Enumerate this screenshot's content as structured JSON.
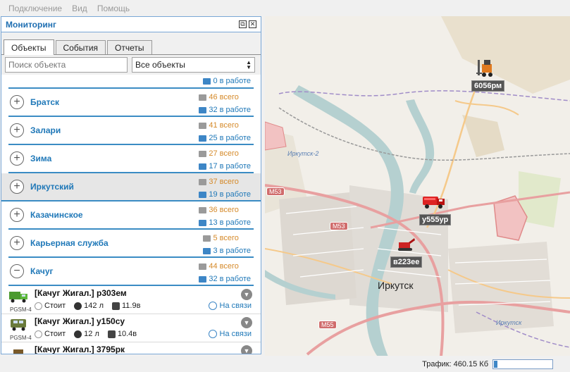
{
  "menu": [
    "Подключение",
    "Вид",
    "Помощь"
  ],
  "panel": {
    "title": "Мониторинг",
    "restore_glyph": "⧉",
    "close_glyph": "✕"
  },
  "tabs": [
    "Объекты",
    "События",
    "Отчеты"
  ],
  "filters": {
    "search_placeholder": "Поиск объекта",
    "select_value": "Все объекты"
  },
  "groups": [
    {
      "name": "",
      "total": "",
      "working": "0 в работе"
    },
    {
      "name": "Братск",
      "total": "46 всего",
      "working": "32 в работе"
    },
    {
      "name": "Залари",
      "total": "41 всего",
      "working": "25 в работе"
    },
    {
      "name": "Зима",
      "total": "27 всего",
      "working": "17 в работе"
    },
    {
      "name": "Иркутский",
      "total": "37 всего",
      "working": "19 в работе"
    },
    {
      "name": "Казачинское",
      "total": "36 всего",
      "working": "13 в работе"
    },
    {
      "name": "Карьерная служба",
      "total": "5 всего",
      "working": "3 в работе"
    },
    {
      "name": "Качуг",
      "total": "44 всего",
      "working": "32 в работе"
    }
  ],
  "vehicles": [
    {
      "title": "[Качуг Жигал.]  р303ем",
      "sub": "PGSM-4",
      "state": "Стоит",
      "fuel": "142 л",
      "battery": "11.9в",
      "link": "На связи"
    },
    {
      "title": "[Качуг Жигал.]  у150су",
      "sub": "PGSM-4",
      "state": "Стоит",
      "fuel": "12 л",
      "battery": "10.4в",
      "link": "На связи"
    },
    {
      "title": "[Качуг Жигал.]  3795рк",
      "sub": "",
      "state": "",
      "fuel": "",
      "battery": "",
      "link": ""
    }
  ],
  "map": {
    "city": "Иркутск",
    "labels": {
      "irkutsk2": "Иркутск-2",
      "irkutsk_river": "Иркутск"
    },
    "roads": {
      "m53a": "M53",
      "m53b": "M53",
      "m55": "M55"
    },
    "markers": [
      {
        "id": "6056рм",
        "label": "6056рм"
      },
      {
        "id": "у555ур",
        "label": "у555ур"
      },
      {
        "id": "в223ее",
        "label": "в223ее"
      }
    ]
  },
  "status": {
    "traffic": "Трафик: 460.15 Кб",
    "traffic_fill": 0.06
  },
  "colors": {
    "accent": "#1f78b8",
    "total": "#d58a2a",
    "water": "#b5d0d0",
    "road": "#e8a0a0"
  }
}
